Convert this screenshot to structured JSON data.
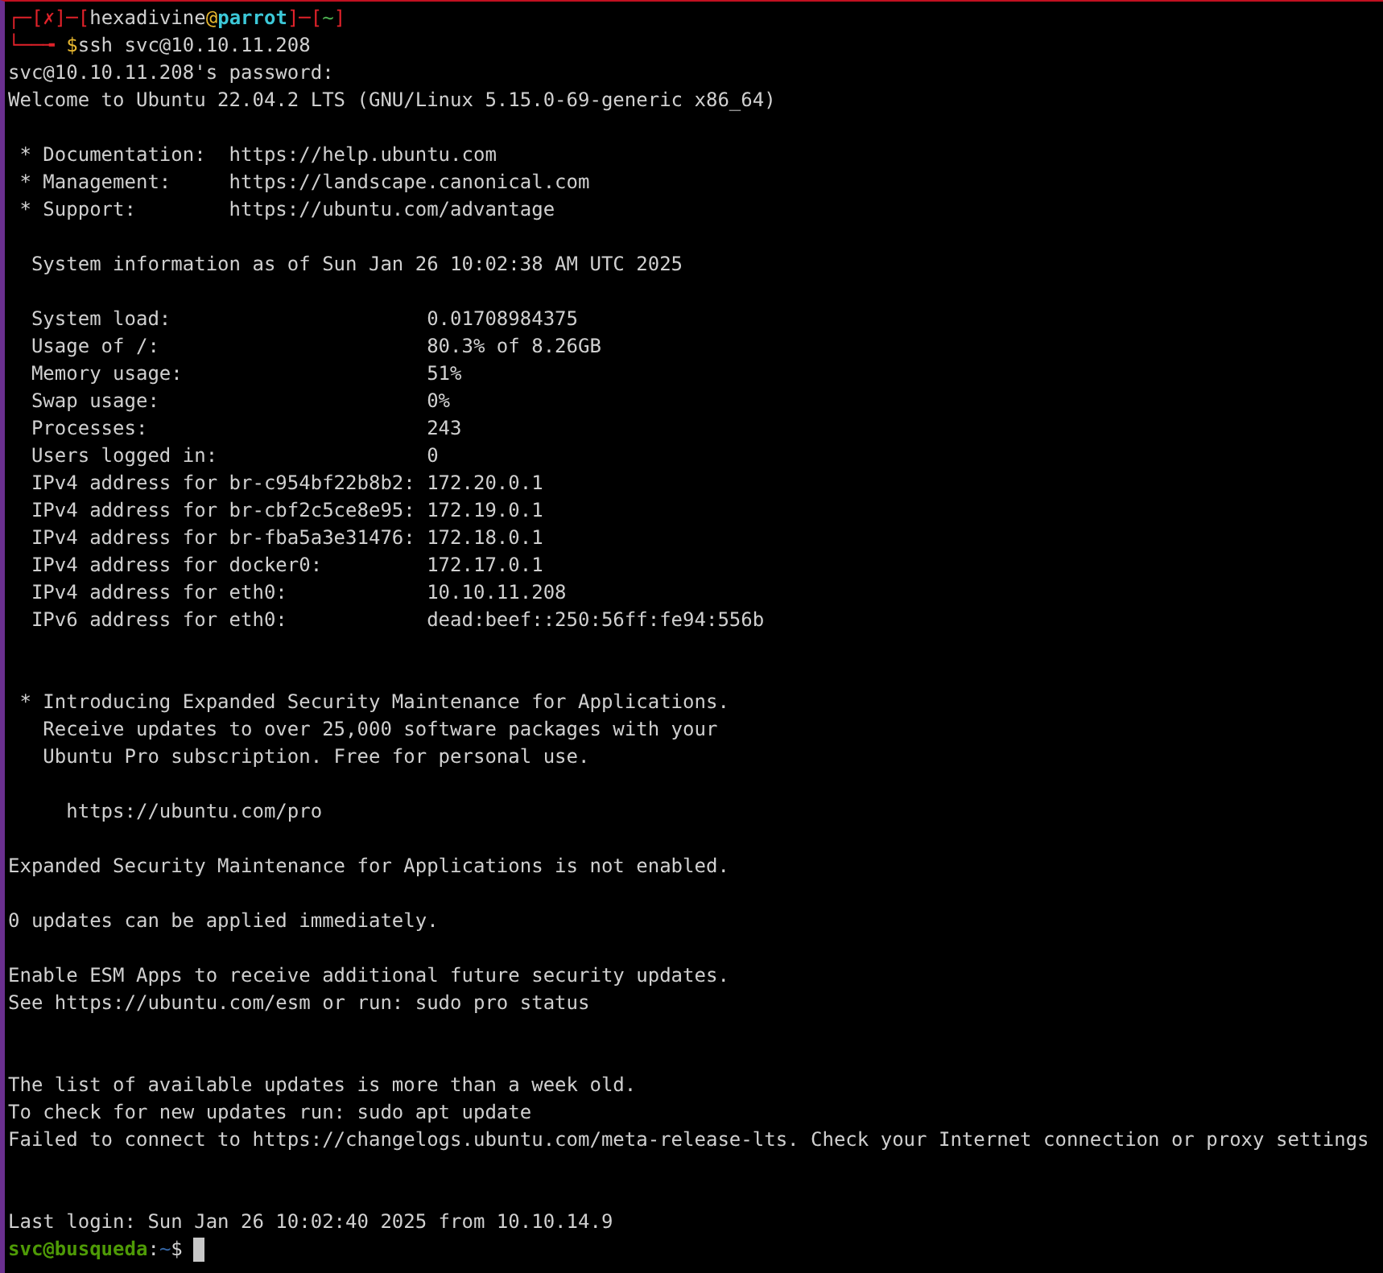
{
  "terminal": {
    "lines": [
      {
        "kind": "prompt",
        "segments": [
          {
            "text": "┌─[",
            "color": "#e0222a"
          },
          {
            "text": "✗",
            "color": "#e0222a"
          },
          {
            "text": "]─[",
            "color": "#e0222a"
          },
          {
            "text": "hexadivine",
            "color": "#d0d0d0"
          },
          {
            "text": "@",
            "color": "#e8b830"
          },
          {
            "text": "parrot",
            "color": "#3cc8d8"
          },
          {
            "text": "]─[",
            "color": "#e0222a"
          },
          {
            "text": "~",
            "color": "#4caf50"
          },
          {
            "text": "]",
            "color": "#e0222a"
          }
        ]
      },
      {
        "kind": "prompt",
        "segments": [
          {
            "text": "└──╼ ",
            "color": "#e0222a"
          },
          {
            "text": "$",
            "color": "#e8b830"
          },
          {
            "text": "ssh svc@10.10.11.208",
            "color": "#d0d0d0"
          }
        ]
      },
      {
        "kind": "text",
        "text": "svc@10.10.11.208's password:"
      },
      {
        "kind": "text",
        "text": "Welcome to Ubuntu 22.04.2 LTS (GNU/Linux 5.15.0-69-generic x86_64)"
      },
      {
        "kind": "blank"
      },
      {
        "kind": "text",
        "text": " * Documentation:  https://help.ubuntu.com"
      },
      {
        "kind": "text",
        "text": " * Management:     https://landscape.canonical.com"
      },
      {
        "kind": "text",
        "text": " * Support:        https://ubuntu.com/advantage"
      },
      {
        "kind": "blank"
      },
      {
        "kind": "text",
        "text": "  System information as of Sun Jan 26 10:02:38 AM UTC 2025"
      },
      {
        "kind": "blank"
      },
      {
        "kind": "text",
        "text": "  System load:                      0.01708984375"
      },
      {
        "kind": "text",
        "text": "  Usage of /:                       80.3% of 8.26GB"
      },
      {
        "kind": "text",
        "text": "  Memory usage:                     51%"
      },
      {
        "kind": "text",
        "text": "  Swap usage:                       0%"
      },
      {
        "kind": "text",
        "text": "  Processes:                        243"
      },
      {
        "kind": "text",
        "text": "  Users logged in:                  0"
      },
      {
        "kind": "text",
        "text": "  IPv4 address for br-c954bf22b8b2: 172.20.0.1"
      },
      {
        "kind": "text",
        "text": "  IPv4 address for br-cbf2c5ce8e95: 172.19.0.1"
      },
      {
        "kind": "text",
        "text": "  IPv4 address for br-fba5a3e31476: 172.18.0.1"
      },
      {
        "kind": "text",
        "text": "  IPv4 address for docker0:         172.17.0.1"
      },
      {
        "kind": "text",
        "text": "  IPv4 address for eth0:            10.10.11.208"
      },
      {
        "kind": "text",
        "text": "  IPv6 address for eth0:            dead:beef::250:56ff:fe94:556b"
      },
      {
        "kind": "blank"
      },
      {
        "kind": "blank"
      },
      {
        "kind": "text",
        "text": " * Introducing Expanded Security Maintenance for Applications."
      },
      {
        "kind": "text",
        "text": "   Receive updates to over 25,000 software packages with your"
      },
      {
        "kind": "text",
        "text": "   Ubuntu Pro subscription. Free for personal use."
      },
      {
        "kind": "blank"
      },
      {
        "kind": "text",
        "text": "     https://ubuntu.com/pro"
      },
      {
        "kind": "blank"
      },
      {
        "kind": "text",
        "text": "Expanded Security Maintenance for Applications is not enabled."
      },
      {
        "kind": "blank"
      },
      {
        "kind": "text",
        "text": "0 updates can be applied immediately."
      },
      {
        "kind": "blank"
      },
      {
        "kind": "text",
        "text": "Enable ESM Apps to receive additional future security updates."
      },
      {
        "kind": "text",
        "text": "See https://ubuntu.com/esm or run: sudo pro status"
      },
      {
        "kind": "blank"
      },
      {
        "kind": "blank"
      },
      {
        "kind": "text",
        "text": "The list of available updates is more than a week old."
      },
      {
        "kind": "text",
        "text": "To check for new updates run: sudo apt update"
      },
      {
        "kind": "text",
        "text": "Failed to connect to https://changelogs.ubuntu.com/meta-release-lts. Check your Internet connection or proxy settings"
      },
      {
        "kind": "blank"
      },
      {
        "kind": "blank"
      },
      {
        "kind": "text",
        "text": "Last login: Sun Jan 26 10:02:40 2025 from 10.10.14.9"
      },
      {
        "kind": "prompt",
        "cursor": true,
        "segments": [
          {
            "text": "svc@busqueda",
            "color": "#4e9a06"
          },
          {
            "text": ":",
            "color": "#d0d0d0"
          },
          {
            "text": "~",
            "color": "#3465a4"
          },
          {
            "text": "$",
            "color": "#d0d0d0"
          }
        ]
      }
    ]
  }
}
